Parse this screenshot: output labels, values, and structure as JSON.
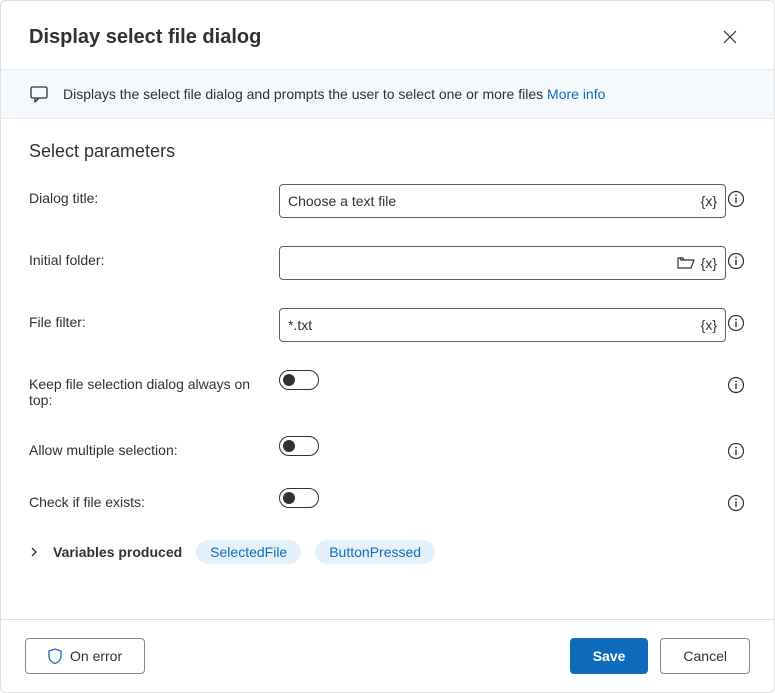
{
  "header": {
    "title": "Display select file dialog"
  },
  "banner": {
    "text": "Displays the select file dialog and prompts the user to select one or more files ",
    "link": "More info"
  },
  "section_title": "Select parameters",
  "params": {
    "dialog_title": {
      "label": "Dialog title:",
      "value": "Choose a text file"
    },
    "initial_folder": {
      "label": "Initial folder:",
      "value": ""
    },
    "file_filter": {
      "label": "File filter:",
      "value": "*.txt"
    },
    "always_on_top": {
      "label": "Keep file selection dialog always on top:",
      "value": false
    },
    "allow_multiple": {
      "label": "Allow multiple selection:",
      "value": false
    },
    "check_exists": {
      "label": "Check if file exists:",
      "value": false
    }
  },
  "variables": {
    "label": "Variables produced",
    "items": [
      "SelectedFile",
      "ButtonPressed"
    ]
  },
  "footer": {
    "on_error": "On error",
    "save": "Save",
    "cancel": "Cancel"
  },
  "var_token": "{x}"
}
